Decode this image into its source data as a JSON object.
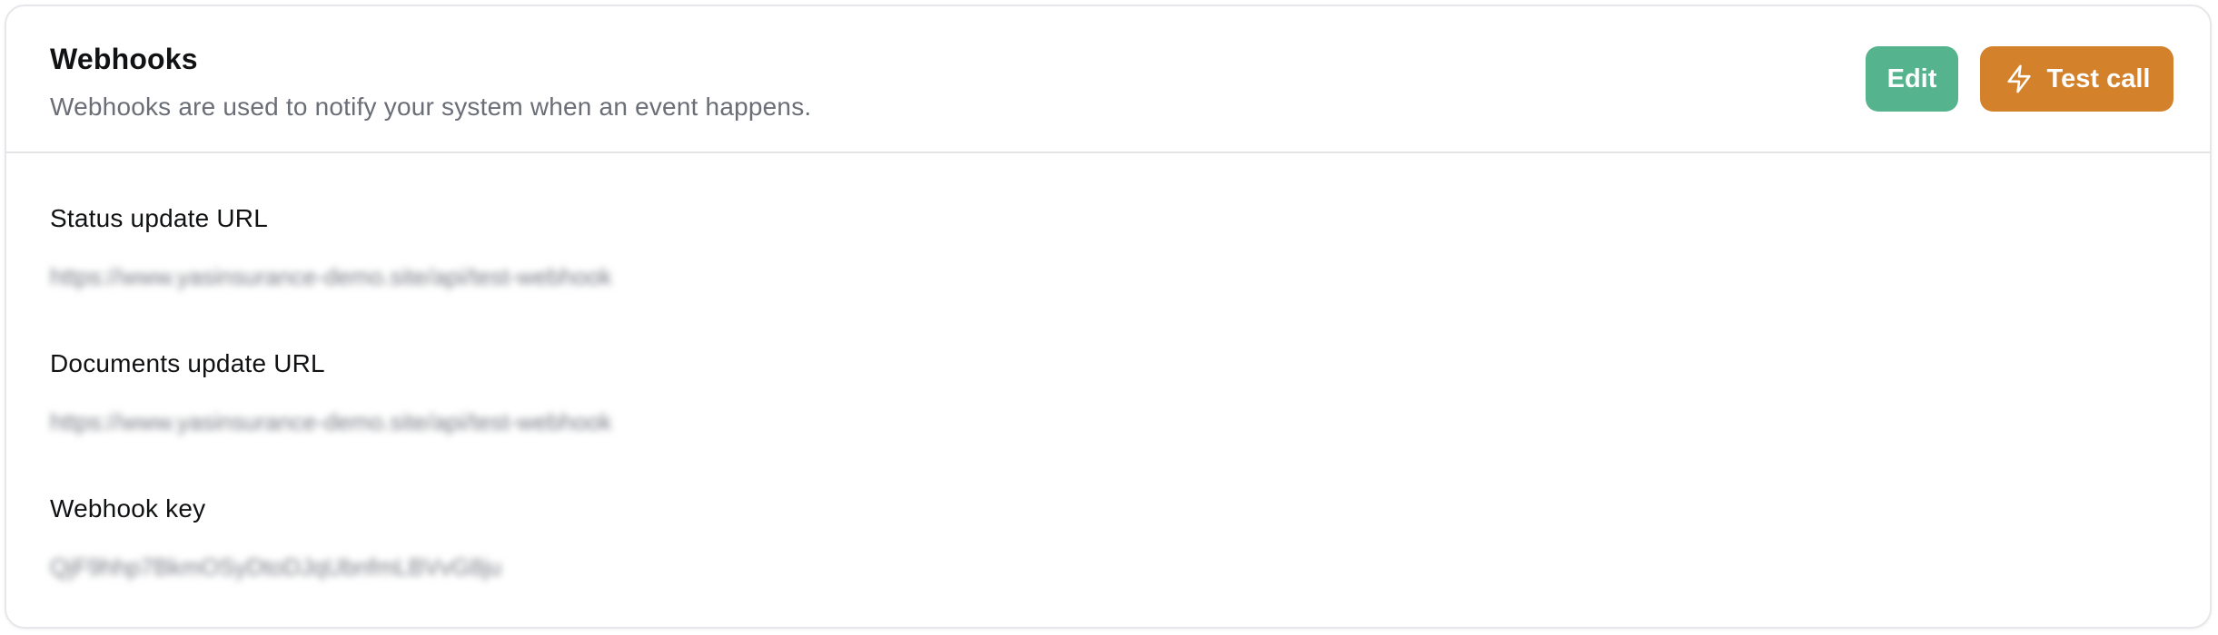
{
  "header": {
    "title": "Webhooks",
    "subtitle": "Webhooks are used to notify your system when an event happens."
  },
  "actions": {
    "edit_label": "Edit",
    "test_call_label": "Test call",
    "test_call_icon": "lightning-bolt-icon"
  },
  "colors": {
    "edit_button": "#55b38d",
    "test_call_button": "#d4812c"
  },
  "fields": [
    {
      "label": "Status update URL",
      "value": "https://www.yasinsurance-demo.site/api/test-webhook"
    },
    {
      "label": "Documents update URL",
      "value": "https://www.yasinsurance-demo.site/api/test-webhook"
    },
    {
      "label": "Webhook key",
      "value": "QjF9hhp7BkmOSyDtoDJqUbnfmLBVvG8ju"
    }
  ]
}
